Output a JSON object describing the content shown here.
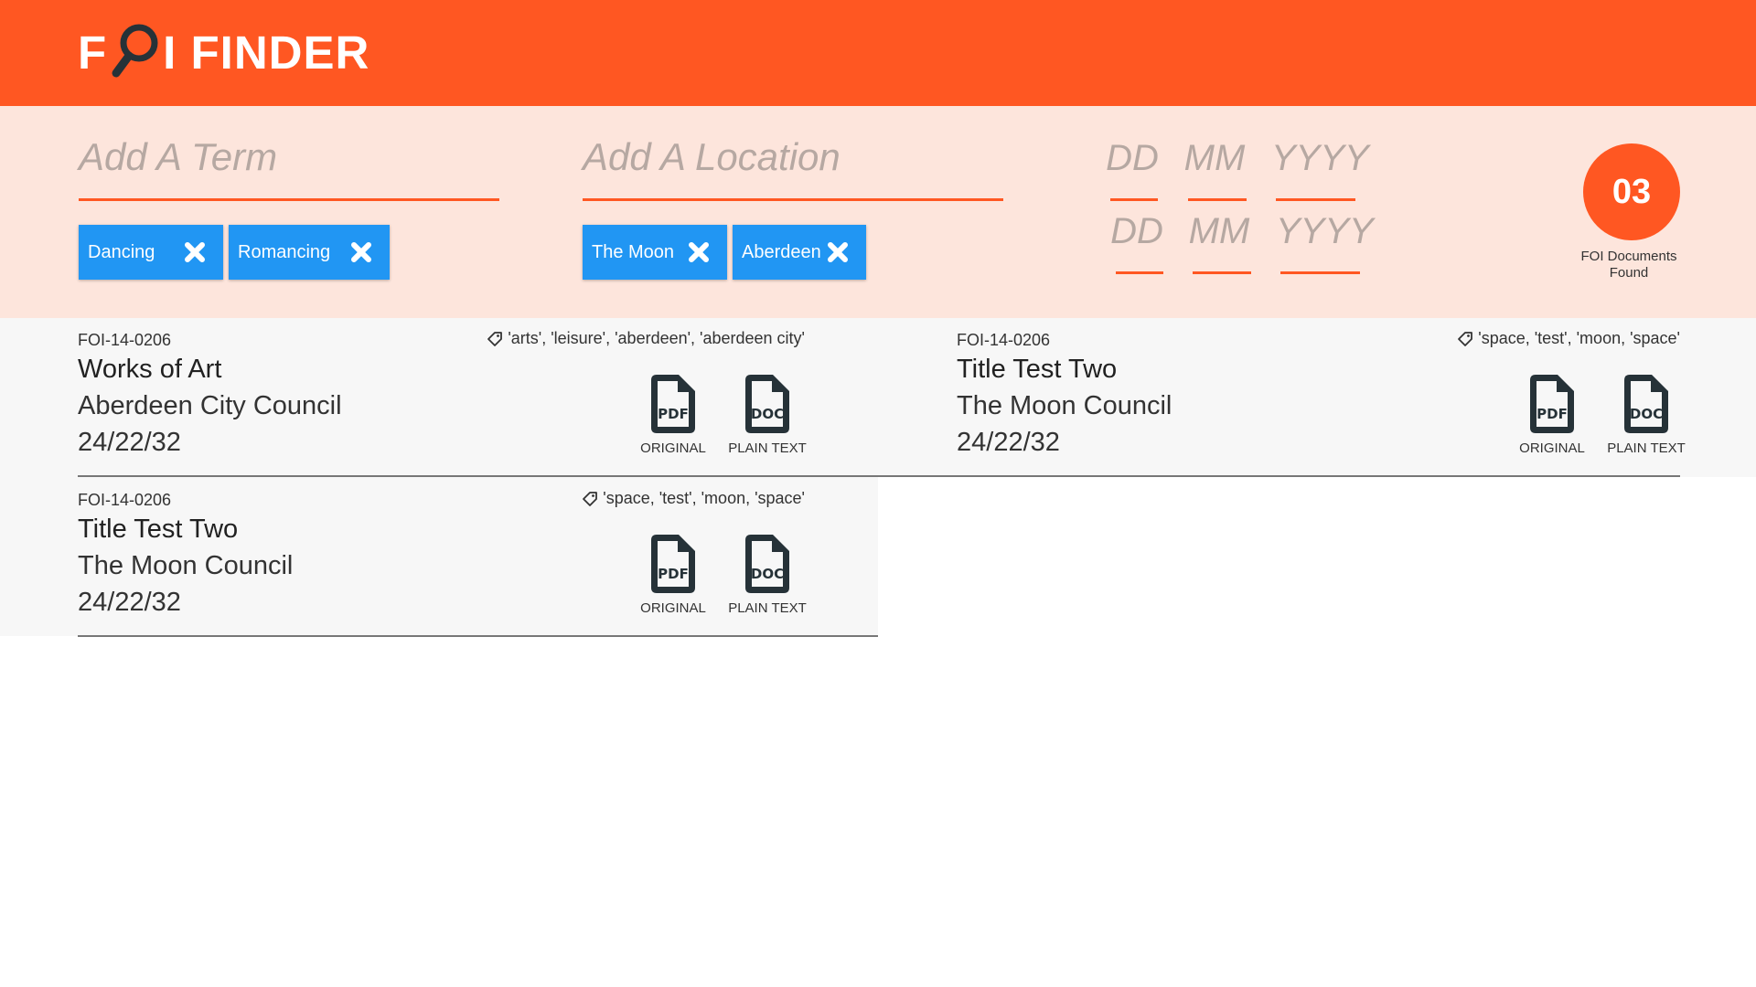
{
  "app": {
    "brand_left": "F",
    "brand_right": "I FINDER",
    "colors": {
      "accent": "#ff5722",
      "chip": "#2196f3",
      "panel": "#fde5dc"
    }
  },
  "search": {
    "term_placeholder": "Add A Term",
    "location_placeholder": "Add A Location",
    "terms": [
      "Dancing",
      "Romancing"
    ],
    "locations": [
      "The Moon",
      "Aberdeen"
    ],
    "date_from": {
      "dd": "DD",
      "mm": "MM",
      "yyyy": "YYYY"
    },
    "date_to": {
      "dd": "DD",
      "mm": "MM",
      "yyyy": "YYYY"
    }
  },
  "results_count": {
    "value": "03",
    "label_line1": "FOI Documents",
    "label_line2": "Found"
  },
  "results": [
    {
      "id": "FOI-14-0206",
      "tags": "'arts', 'leisure', 'aberdeen', 'aberdeen city'",
      "title": "Works of Art",
      "council": "Aberdeen City Council",
      "date": "24/22/32",
      "pdf_icon_text": "PDF",
      "pdf_label": "ORIGINAL",
      "doc_icon_text": "DOC",
      "doc_label": "PLAIN TEXT"
    },
    {
      "id": "FOI-14-0206",
      "tags": "'space, 'test', 'moon, 'space'",
      "title": "Title Test Two",
      "council": "The Moon Council",
      "date": "24/22/32",
      "pdf_icon_text": "PDF",
      "pdf_label": "ORIGINAL",
      "doc_icon_text": "DOC",
      "doc_label": "PLAIN TEXT"
    },
    {
      "id": "FOI-14-0206",
      "tags": "'space, 'test', 'moon, 'space'",
      "title": "Title Test Two",
      "council": "The Moon Council",
      "date": "24/22/32",
      "pdf_icon_text": "PDF",
      "pdf_label": "ORIGINAL",
      "doc_icon_text": "DOC",
      "doc_label": "PLAIN TEXT"
    }
  ],
  "icons": {
    "logo": "magnifier-icon",
    "chip_remove": "close-icon",
    "tag": "tag-icon",
    "pdf": "pdf-file-icon",
    "doc": "doc-file-icon"
  }
}
